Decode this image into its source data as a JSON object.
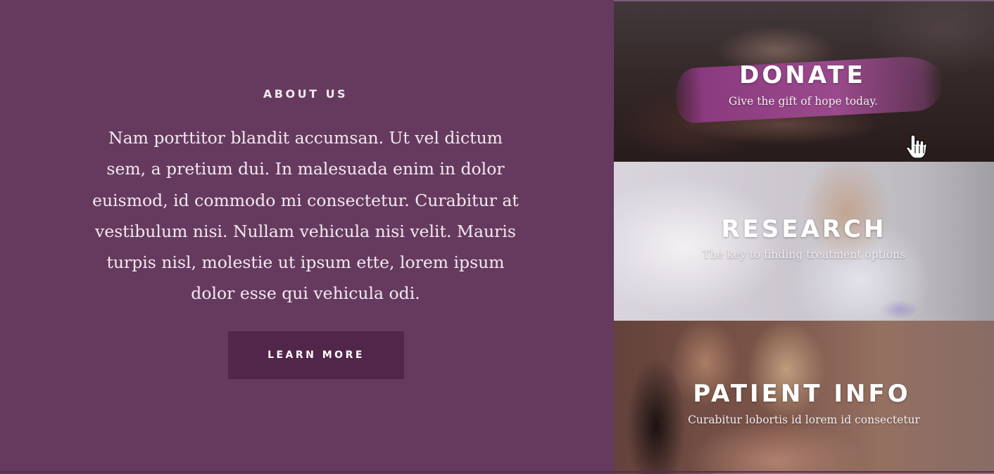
{
  "about": {
    "title": "ABOUT US",
    "body": "Nam porttitor blandit accumsan. Ut vel dictum sem, a pretium dui. In malesuada enim in dolor euismod, id commodo mi consectetur. Curabitur at vestibulum nisi. Nullam vehicula nisi velit. Mauris turpis nisl, molestie ut ipsum ette, lorem ipsum dolor esse qui vehicula odi.",
    "button_label": "LEARN MORE"
  },
  "cards": [
    {
      "title": "DONATE",
      "subtitle": "Give the gift of hope today."
    },
    {
      "title": "RESEARCH",
      "subtitle": "The key to finding treatment options"
    },
    {
      "title": "PATIENT INFO",
      "subtitle": "Curabitur lobortis id lorem  id consectetur"
    }
  ],
  "colors": {
    "background": "#663a5f",
    "button": "#52264a",
    "brush_accent": "#8a3a7e",
    "text_light": "#f2e9f0"
  },
  "icons": {
    "cursor": "hand-pointer-icon"
  }
}
